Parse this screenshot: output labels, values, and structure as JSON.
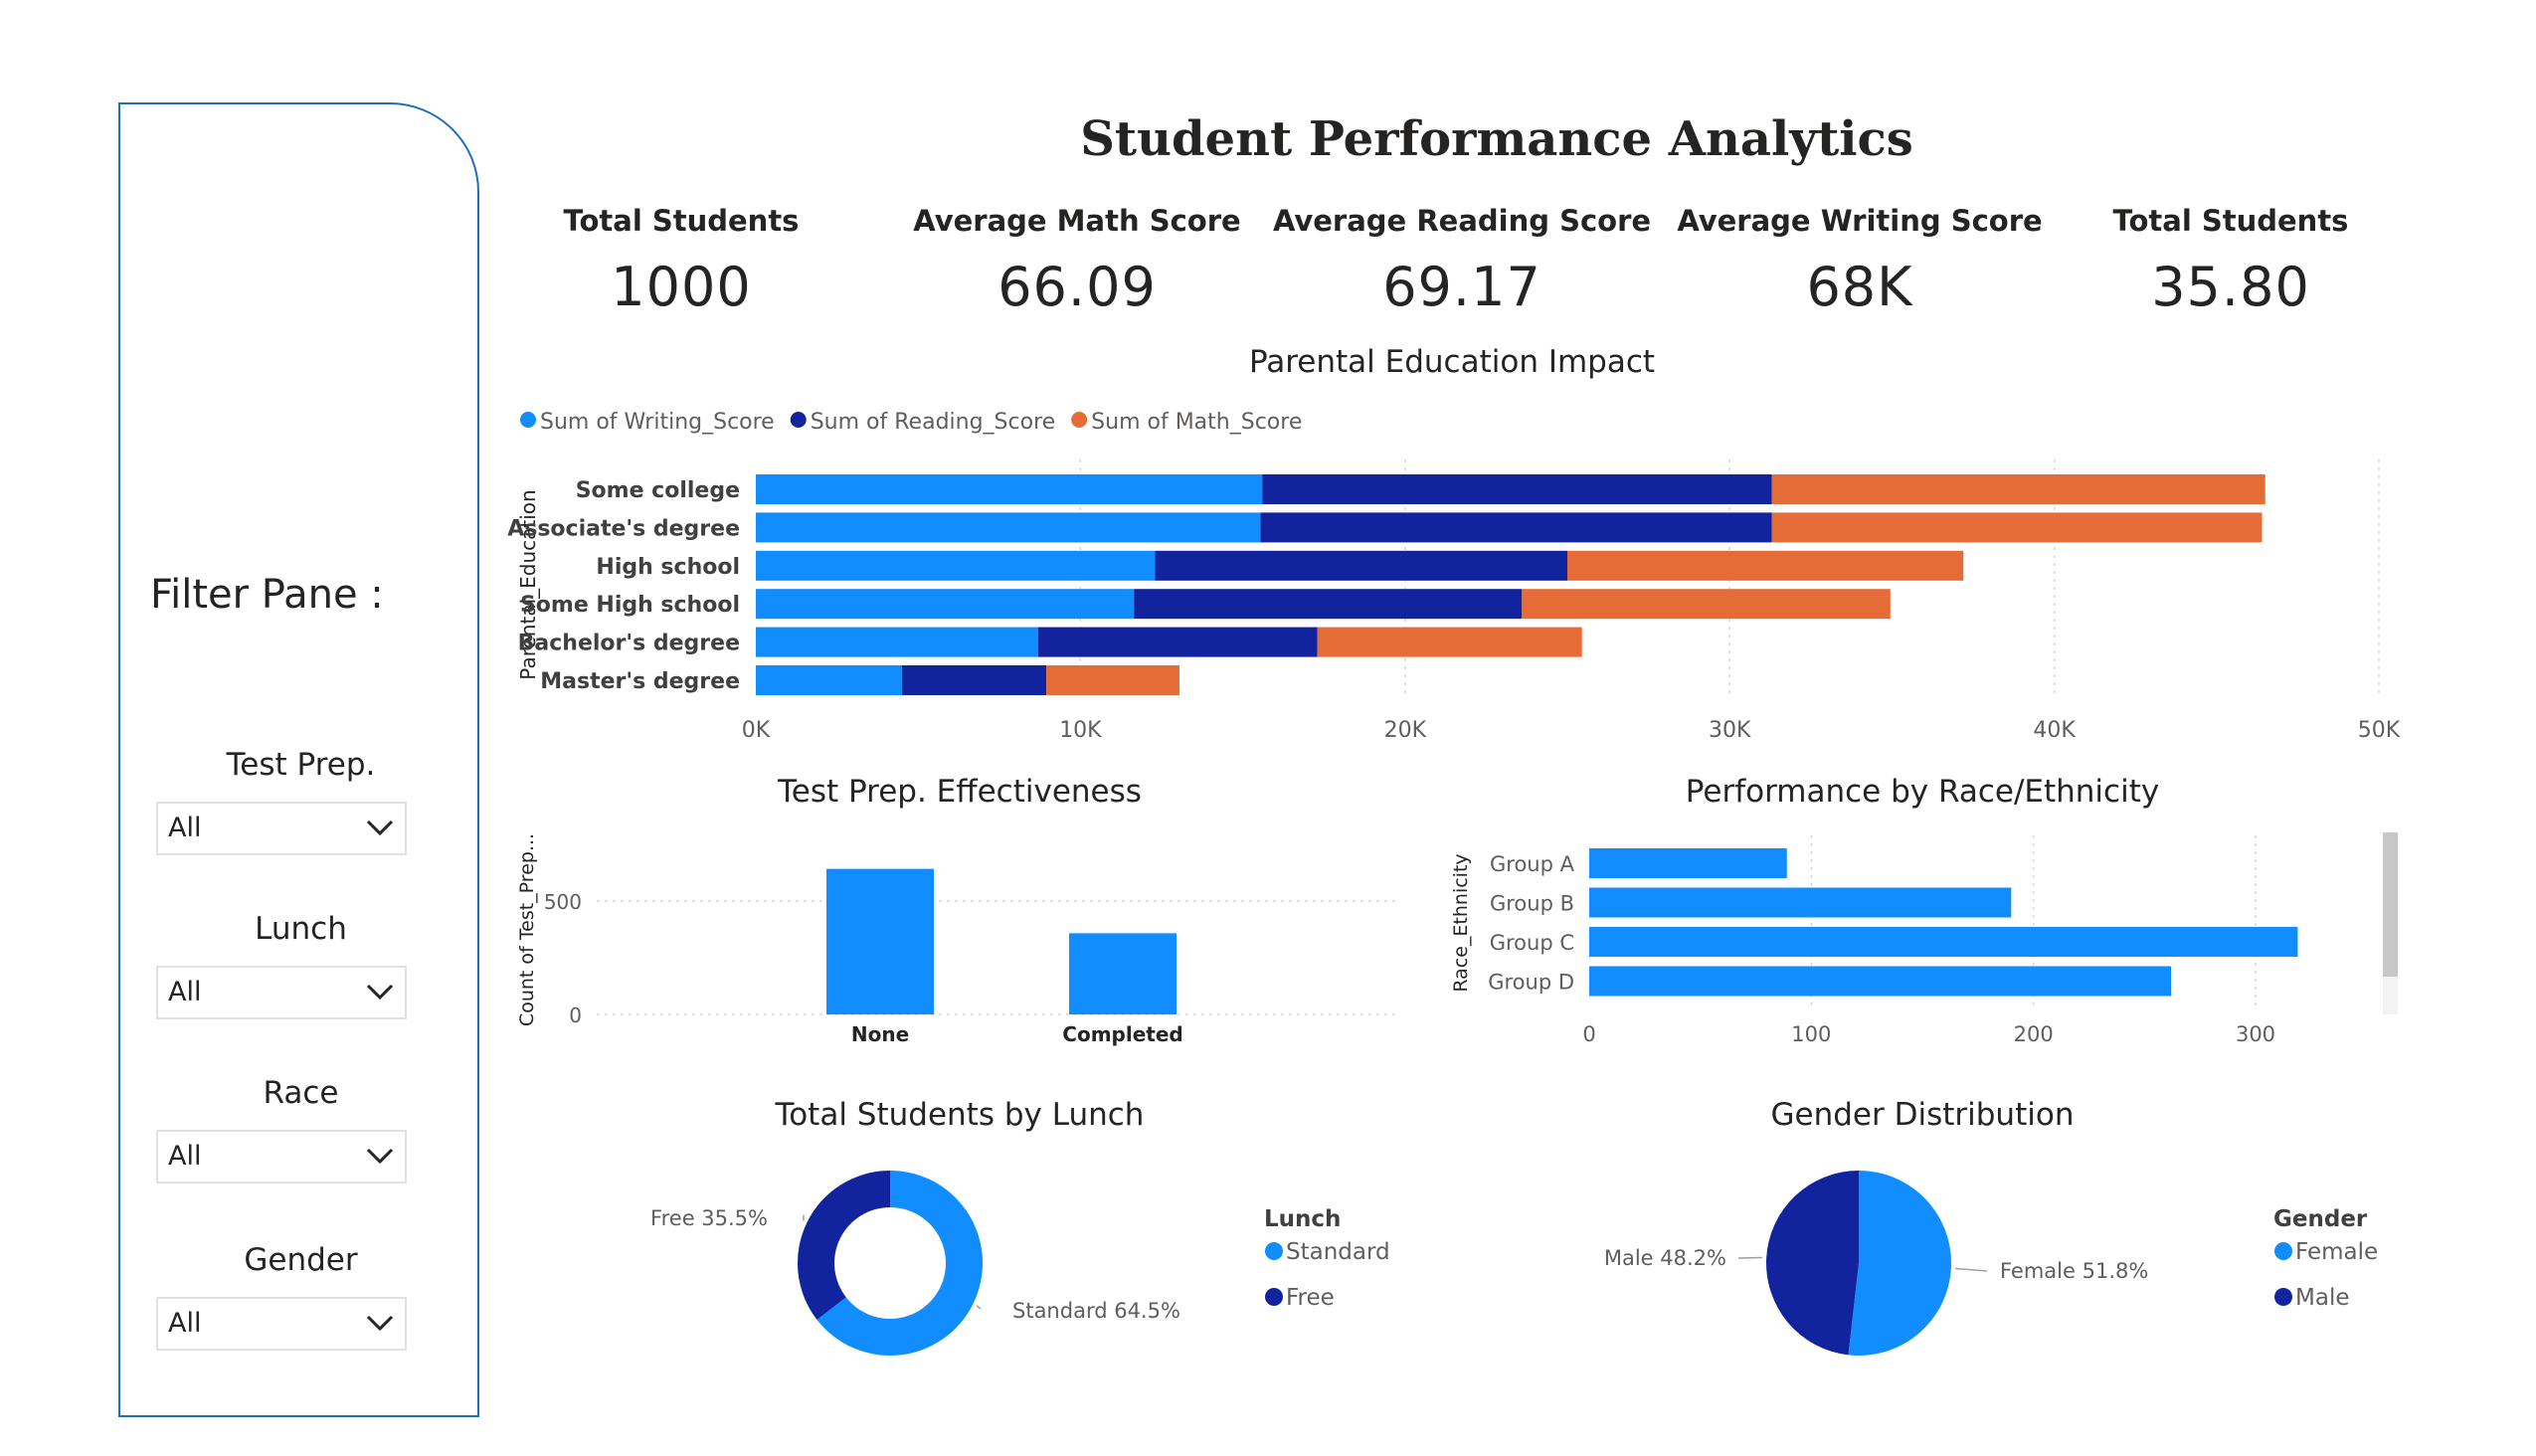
{
  "dashboard": {
    "title": "Student Performance Analytics"
  },
  "kpis": [
    {
      "label": "Total Students",
      "value": "1000"
    },
    {
      "label": "Average Math Score",
      "value": "66.09"
    },
    {
      "label": "Average Reading Score",
      "value": "69.17"
    },
    {
      "label": "Average Writing Score",
      "value": "68K"
    },
    {
      "label": "Total Students",
      "value": "35.80"
    }
  ],
  "filters": {
    "title": "Filter Pane :",
    "items": [
      {
        "label": "Test Prep.",
        "value": "All"
      },
      {
        "label": "Lunch",
        "value": "All"
      },
      {
        "label": "Race",
        "value": "All"
      },
      {
        "label": "Gender",
        "value": "All"
      }
    ]
  },
  "colors": {
    "light_blue": "#118dff",
    "dark_blue": "#12239e",
    "orange": "#e66c37",
    "border_blue": "#1f6dbf"
  },
  "chart_data": [
    {
      "type": "bar",
      "orientation": "horizontal",
      "stacked": true,
      "title": "Parental Education Impact",
      "ylabel": "Parental_Education",
      "categories": [
        "Some college",
        "Associate's degree",
        "High school",
        "Some High school",
        "Bachelor's degree",
        "Master's degree"
      ],
      "series": [
        {
          "name": "Sum of Writing_Score",
          "color": "#118dff",
          "values": [
            15600,
            15550,
            12300,
            11650,
            8700,
            4500
          ]
        },
        {
          "name": "Sum of Reading_Score",
          "color": "#12239e",
          "values": [
            15700,
            15750,
            12700,
            11950,
            8600,
            4450
          ]
        },
        {
          "name": "Sum of Math_Score",
          "color": "#e66c37",
          "values": [
            15200,
            15100,
            12200,
            11350,
            8150,
            4100
          ]
        }
      ],
      "xlim": [
        0,
        50000
      ],
      "xticks": [
        "0K",
        "10K",
        "20K",
        "30K",
        "40K",
        "50K"
      ],
      "legend_position": "top-left",
      "grid": true
    },
    {
      "type": "bar",
      "title": "Test Prep. Effectiveness",
      "ylabel": "Count of Test_Prep...",
      "categories": [
        "None",
        "Completed"
      ],
      "values": [
        642,
        358
      ],
      "color": "#118dff",
      "yticks": [
        "0",
        "500"
      ],
      "ylim": [
        0,
        700
      ],
      "grid": true
    },
    {
      "type": "bar",
      "orientation": "horizontal",
      "title": "Performance by Race/Ethnicity",
      "ylabel": "Race_Ethnicity",
      "categories": [
        "Group A",
        "Group B",
        "Group C",
        "Group D"
      ],
      "values": [
        89,
        190,
        319,
        262
      ],
      "color": "#118dff",
      "xlim": [
        0,
        340
      ],
      "xticks": [
        "0",
        "100",
        "200",
        "300"
      ],
      "grid": true
    },
    {
      "type": "pie",
      "donut": true,
      "title": "Total Students by Lunch",
      "legend_title": "Lunch",
      "slices": [
        {
          "label": "Standard",
          "value": 64.5,
          "color": "#118dff",
          "data_label": "Standard 64.5%"
        },
        {
          "label": "Free",
          "value": 35.5,
          "color": "#12239e",
          "data_label": "Free 35.5%"
        }
      ]
    },
    {
      "type": "pie",
      "title": "Gender Distribution",
      "legend_title": "Gender",
      "slices": [
        {
          "label": "Female",
          "value": 51.8,
          "color": "#118dff",
          "data_label": "Female 51.8%"
        },
        {
          "label": "Male",
          "value": 48.2,
          "color": "#12239e",
          "data_label": "Male 48.2%"
        }
      ]
    }
  ]
}
